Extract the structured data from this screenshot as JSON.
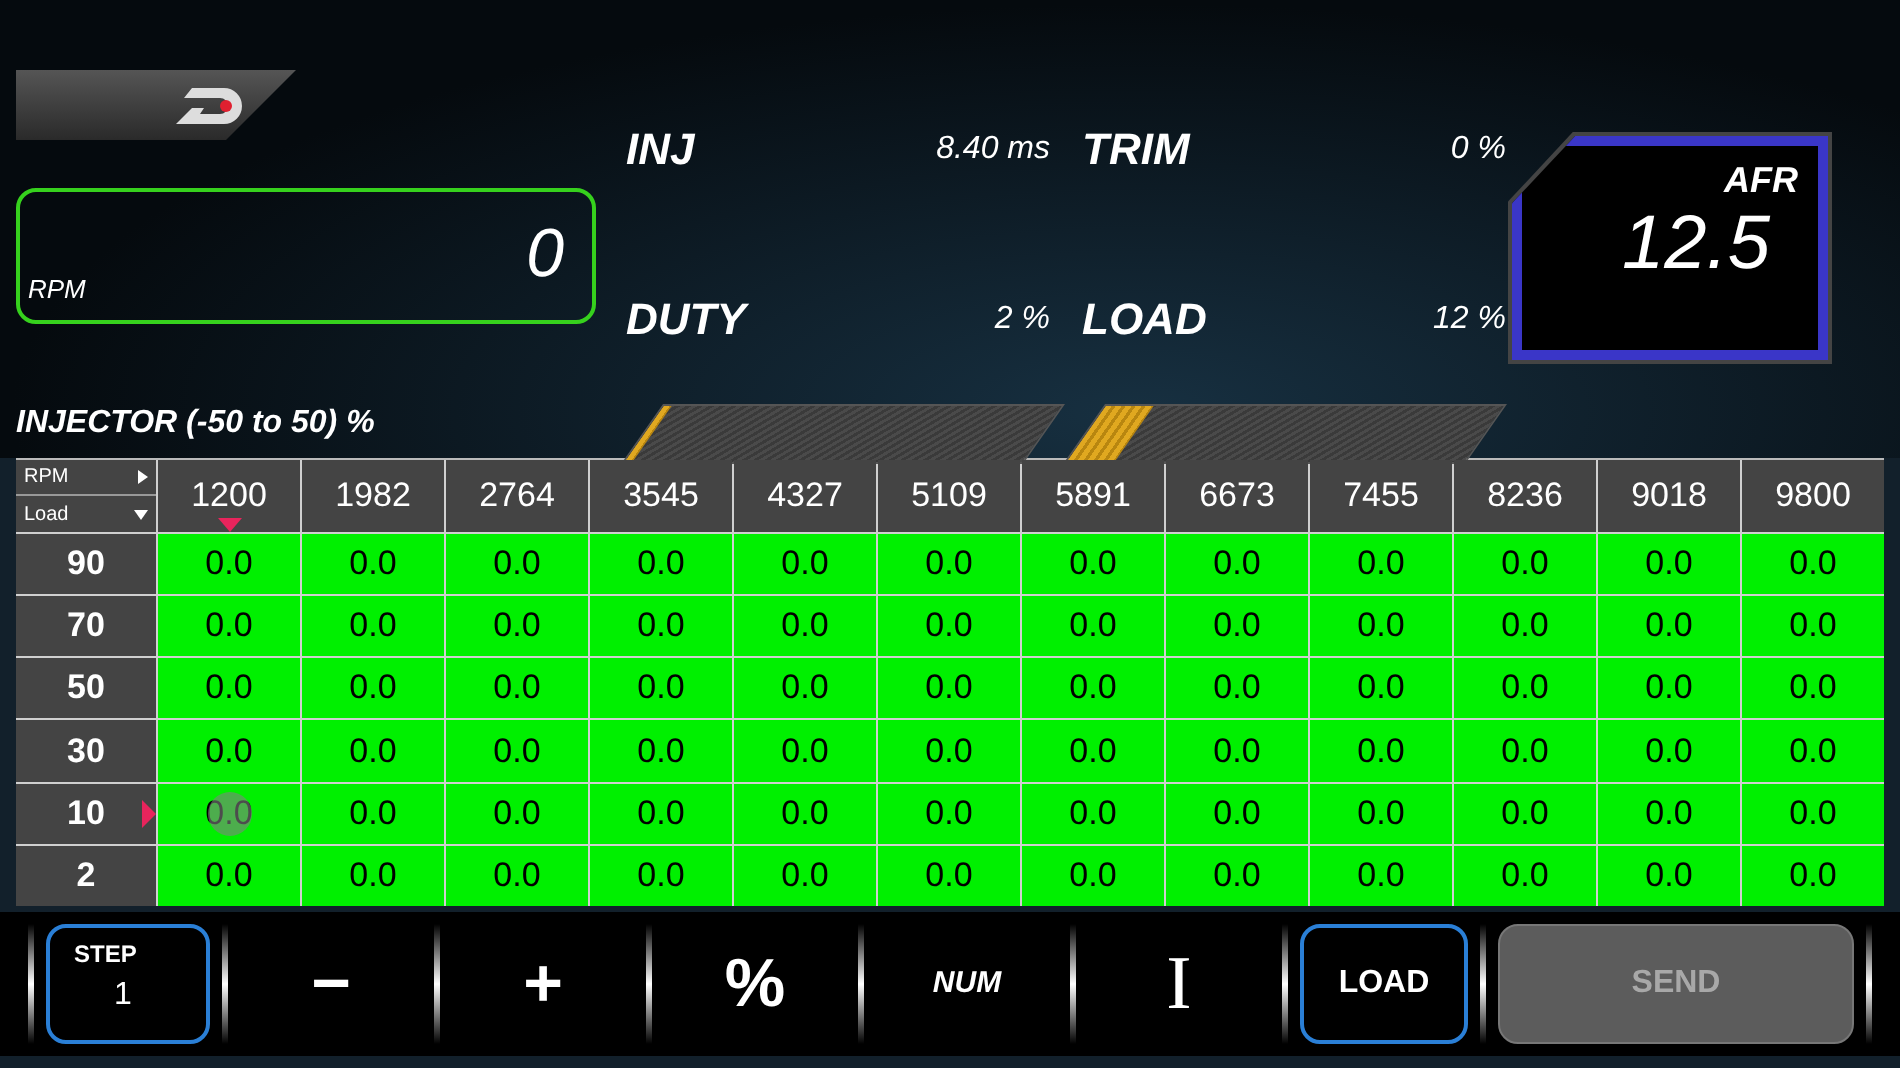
{
  "rpm_display": {
    "label": "RPM",
    "value": "0"
  },
  "readouts": [
    {
      "label": "INJ",
      "value": "8.40 ms"
    },
    {
      "label": "TRIM",
      "value": "0 %"
    },
    {
      "label": "DUTY",
      "value": "2 %"
    },
    {
      "label": "LOAD",
      "value": "12 %"
    }
  ],
  "gauges": [
    {
      "level": 0.02
    },
    {
      "level": 0.12
    }
  ],
  "afr": {
    "label": "AFR",
    "value": "12.5"
  },
  "table": {
    "title": "INJECTOR (-50 to 50) %",
    "x_axis": "RPM",
    "y_axis": "Load",
    "columns": [
      {
        "label": "1200",
        "cursor": true
      },
      {
        "label": "1982",
        "cursor": false
      },
      {
        "label": "2764",
        "cursor": false
      },
      {
        "label": "3545",
        "cursor": false
      },
      {
        "label": "4327",
        "cursor": false
      },
      {
        "label": "5109",
        "cursor": false
      },
      {
        "label": "5891",
        "cursor": false
      },
      {
        "label": "6673",
        "cursor": false
      },
      {
        "label": "7455",
        "cursor": false
      },
      {
        "label": "8236",
        "cursor": false
      },
      {
        "label": "9018",
        "cursor": false
      },
      {
        "label": "9800",
        "cursor": false
      }
    ],
    "rows": [
      {
        "label": "90",
        "cursor": false,
        "cells": [
          {
            "value": "0.0",
            "touched": false
          },
          {
            "value": "0.0",
            "touched": false
          },
          {
            "value": "0.0",
            "touched": false
          },
          {
            "value": "0.0",
            "touched": false
          },
          {
            "value": "0.0",
            "touched": false
          },
          {
            "value": "0.0",
            "touched": false
          },
          {
            "value": "0.0",
            "touched": false
          },
          {
            "value": "0.0",
            "touched": false
          },
          {
            "value": "0.0",
            "touched": false
          },
          {
            "value": "0.0",
            "touched": false
          },
          {
            "value": "0.0",
            "touched": false
          },
          {
            "value": "0.0",
            "touched": false
          }
        ]
      },
      {
        "label": "70",
        "cursor": false,
        "cells": [
          {
            "value": "0.0",
            "touched": false
          },
          {
            "value": "0.0",
            "touched": false
          },
          {
            "value": "0.0",
            "touched": false
          },
          {
            "value": "0.0",
            "touched": false
          },
          {
            "value": "0.0",
            "touched": false
          },
          {
            "value": "0.0",
            "touched": false
          },
          {
            "value": "0.0",
            "touched": false
          },
          {
            "value": "0.0",
            "touched": false
          },
          {
            "value": "0.0",
            "touched": false
          },
          {
            "value": "0.0",
            "touched": false
          },
          {
            "value": "0.0",
            "touched": false
          },
          {
            "value": "0.0",
            "touched": false
          }
        ]
      },
      {
        "label": "50",
        "cursor": false,
        "cells": [
          {
            "value": "0.0",
            "touched": false
          },
          {
            "value": "0.0",
            "touched": false
          },
          {
            "value": "0.0",
            "touched": false
          },
          {
            "value": "0.0",
            "touched": false
          },
          {
            "value": "0.0",
            "touched": false
          },
          {
            "value": "0.0",
            "touched": false
          },
          {
            "value": "0.0",
            "touched": false
          },
          {
            "value": "0.0",
            "touched": false
          },
          {
            "value": "0.0",
            "touched": false
          },
          {
            "value": "0.0",
            "touched": false
          },
          {
            "value": "0.0",
            "touched": false
          },
          {
            "value": "0.0",
            "touched": false
          }
        ]
      },
      {
        "label": "30",
        "cursor": false,
        "cells": [
          {
            "value": "0.0",
            "touched": false
          },
          {
            "value": "0.0",
            "touched": false
          },
          {
            "value": "0.0",
            "touched": false
          },
          {
            "value": "0.0",
            "touched": false
          },
          {
            "value": "0.0",
            "touched": false
          },
          {
            "value": "0.0",
            "touched": false
          },
          {
            "value": "0.0",
            "touched": false
          },
          {
            "value": "0.0",
            "touched": false
          },
          {
            "value": "0.0",
            "touched": false
          },
          {
            "value": "0.0",
            "touched": false
          },
          {
            "value": "0.0",
            "touched": false
          },
          {
            "value": "0.0",
            "touched": false
          }
        ]
      },
      {
        "label": "10",
        "cursor": true,
        "cells": [
          {
            "value": "0.0",
            "touched": true
          },
          {
            "value": "0.0",
            "touched": false
          },
          {
            "value": "0.0",
            "touched": false
          },
          {
            "value": "0.0",
            "touched": false
          },
          {
            "value": "0.0",
            "touched": false
          },
          {
            "value": "0.0",
            "touched": false
          },
          {
            "value": "0.0",
            "touched": false
          },
          {
            "value": "0.0",
            "touched": false
          },
          {
            "value": "0.0",
            "touched": false
          },
          {
            "value": "0.0",
            "touched": false
          },
          {
            "value": "0.0",
            "touched": false
          },
          {
            "value": "0.0",
            "touched": false
          }
        ]
      },
      {
        "label": "2",
        "cursor": false,
        "cells": [
          {
            "value": "0.0",
            "touched": false
          },
          {
            "value": "0.0",
            "touched": false
          },
          {
            "value": "0.0",
            "touched": false
          },
          {
            "value": "0.0",
            "touched": false
          },
          {
            "value": "0.0",
            "touched": false
          },
          {
            "value": "0.0",
            "touched": false
          },
          {
            "value": "0.0",
            "touched": false
          },
          {
            "value": "0.0",
            "touched": false
          },
          {
            "value": "0.0",
            "touched": false
          },
          {
            "value": "0.0",
            "touched": false
          },
          {
            "value": "0.0",
            "touched": false
          },
          {
            "value": "0.0",
            "touched": false
          }
        ]
      }
    ]
  },
  "toolbar": [
    {
      "kind": "step",
      "label": "STEP",
      "value": "1"
    },
    {
      "kind": "plain",
      "label": "−"
    },
    {
      "kind": "plain",
      "label": "+"
    },
    {
      "kind": "plain",
      "label": "%"
    },
    {
      "kind": "small",
      "label": "NUM"
    },
    {
      "kind": "serif",
      "label": "I"
    },
    {
      "kind": "outlined",
      "label": "LOAD"
    },
    {
      "kind": "filled",
      "label": "SEND",
      "disabled": true
    }
  ]
}
